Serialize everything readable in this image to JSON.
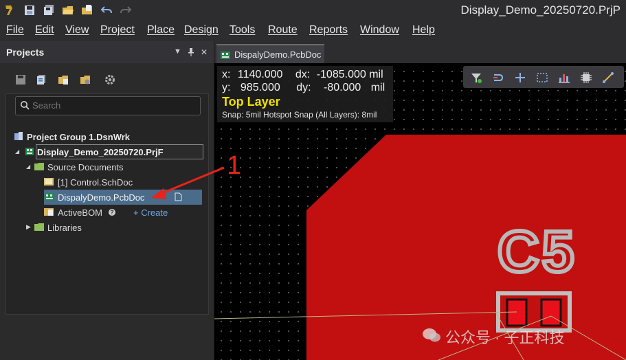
{
  "window": {
    "title": "Display_Demo_20250720.PrjP"
  },
  "quick_toolbar": {
    "icons": [
      "app-logo-icon",
      "save-icon",
      "save-all-icon",
      "open-folder-icon",
      "open-project-icon",
      "undo-icon",
      "redo-icon"
    ]
  },
  "menu": {
    "items": [
      "File",
      "Edit",
      "View",
      "Project",
      "Place",
      "Design",
      "Tools",
      "Route",
      "Reports",
      "Window",
      "Help"
    ]
  },
  "projects_panel": {
    "title": "Projects",
    "controls": [
      "▼",
      "📌",
      "✕"
    ],
    "toolbar_icons": [
      "save-project-icon",
      "compile-icon",
      "open-doc-folder-icon",
      "folder-settings-icon",
      "gear-icon"
    ],
    "search_placeholder": "Search",
    "tree": {
      "group": "Project Group 1.DsnWrk",
      "project": "Display_Demo_20250720.PrjF",
      "source_folder": "Source Documents",
      "sch_doc": "[1] Control.SchDoc",
      "pcb_doc": "DispalyDemo.PcbDoc",
      "activebom": "ActiveBOM",
      "activebom_help": "?",
      "create": "+ Create",
      "libraries": "Libraries"
    }
  },
  "editor": {
    "tab_label": "DispalyDemo.PcbDoc",
    "hud": {
      "x_label": "x:",
      "x_value": "1140.000",
      "dx_label": "dx:",
      "dx_value": "-1085.000 mil",
      "y_label": "y:",
      "y_value": "985.000",
      "dy_label": "dy:",
      "dy_value": "-80.000",
      "dy_unit": "mil",
      "layer": "Top Layer",
      "snap": "Snap: 5mil Hotspot Snap (All Layers): 8mil"
    },
    "float_toolbar_icons": [
      "filter-icon",
      "route-icon",
      "add-icon",
      "select-rect-icon",
      "chart-icon",
      "component-icon",
      "interactive-route-icon"
    ],
    "designator": "C5",
    "colors": {
      "board_copper": "#c20f0f",
      "layer_text": "#f0e000",
      "pad": "#e8101a",
      "annotation": "#e8231a"
    }
  },
  "annotation": {
    "number": "1"
  },
  "watermark": {
    "text": "公众号 · 子正科技"
  }
}
